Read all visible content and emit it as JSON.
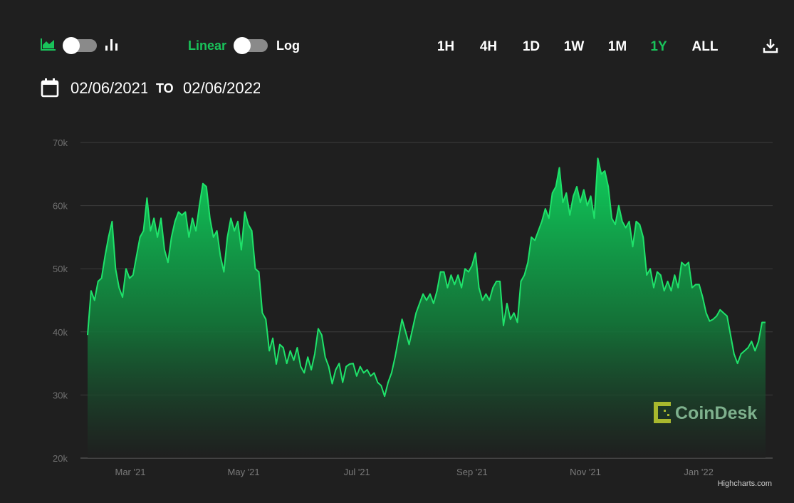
{
  "controls": {
    "linear_label": "Linear",
    "log_label": "Log",
    "ranges": [
      "1H",
      "4H",
      "1D",
      "1W",
      "1M",
      "1Y",
      "ALL"
    ],
    "active_range": "1Y",
    "date_from": "02/06/2021",
    "date_to_label": "TO",
    "date_to": "02/06/2022"
  },
  "colors": {
    "accent": "#19c35a",
    "line": "#1fe26a",
    "background": "#1f1f1f",
    "grid": "#3c3c3c"
  },
  "watermark": "CoinDesk",
  "credits": "Highcharts.com",
  "chart_data": {
    "type": "area",
    "title": "",
    "xlabel": "",
    "ylabel": "",
    "x_start": "2021-02-06",
    "x_end": "2022-02-06",
    "ylim": [
      20000,
      70000
    ],
    "yticks": [
      20000,
      30000,
      40000,
      50000,
      60000,
      70000
    ],
    "ytick_labels": [
      "20k",
      "30k",
      "40k",
      "50k",
      "60k",
      "70k"
    ],
    "xticks": [
      {
        "date": "2021-03-01",
        "label": "Mar '21"
      },
      {
        "date": "2021-05-01",
        "label": "May '21"
      },
      {
        "date": "2021-07-01",
        "label": "Jul '21"
      },
      {
        "date": "2021-09-01",
        "label": "Sep '21"
      },
      {
        "date": "2021-11-01",
        "label": "Nov '21"
      },
      {
        "date": "2022-01-01",
        "label": "Jan '22"
      }
    ],
    "grid": true,
    "values": [
      39500,
      46500,
      45000,
      48000,
      48500,
      52000,
      55000,
      57500,
      50000,
      47000,
      45500,
      50000,
      48500,
      49000,
      52000,
      55000,
      56000,
      61200,
      56000,
      58000,
      55000,
      58000,
      53000,
      51000,
      55000,
      57500,
      59000,
      58500,
      59000,
      55000,
      58000,
      56000,
      60000,
      63500,
      63000,
      58000,
      55000,
      56000,
      52000,
      49500,
      55000,
      58000,
      56000,
      57500,
      53000,
      59000,
      57000,
      56000,
      50000,
      49500,
      43000,
      42000,
      37000,
      39000,
      34900,
      38000,
      37500,
      35000,
      37000,
      35500,
      37500,
      34500,
      33500,
      36000,
      34000,
      36500,
      40500,
      39500,
      36000,
      34500,
      31800,
      34000,
      35000,
      32000,
      34500,
      34900,
      35000,
      33000,
      34500,
      33500,
      34000,
      33000,
      33500,
      32000,
      31500,
      29800,
      32000,
      33500,
      36000,
      39000,
      42000,
      40000,
      38000,
      40500,
      43000,
      44500,
      46000,
      45000,
      46000,
      44500,
      46500,
      49500,
      49500,
      47000,
      49000,
      47500,
      49000,
      47000,
      50000,
      49500,
      50500,
      52500,
      47000,
      45000,
      46000,
      45000,
      47000,
      48000,
      48000,
      41000,
      44500,
      42000,
      43000,
      41500,
      48000,
      49000,
      51000,
      55000,
      54500,
      56000,
      57500,
      59500,
      58000,
      62000,
      63000,
      66000,
      60500,
      62000,
      58500,
      61500,
      63000,
      60500,
      62500,
      60000,
      61500,
      58000,
      67500,
      65000,
      65500,
      63000,
      58000,
      57000,
      60000,
      57500,
      56500,
      57500,
      53500,
      57500,
      57000,
      55000,
      49000,
      50000,
      47000,
      49500,
      49000,
      46500,
      48000,
      46500,
      49000,
      47000,
      51000,
      50500,
      51000,
      47000,
      47500,
      47500,
      45500,
      43000,
      41700,
      42000,
      42500,
      43500,
      43000,
      42500,
      39500,
      36500,
      35000,
      36500,
      37000,
      37500,
      38500,
      37000,
      38500,
      41500,
      41500
    ]
  }
}
